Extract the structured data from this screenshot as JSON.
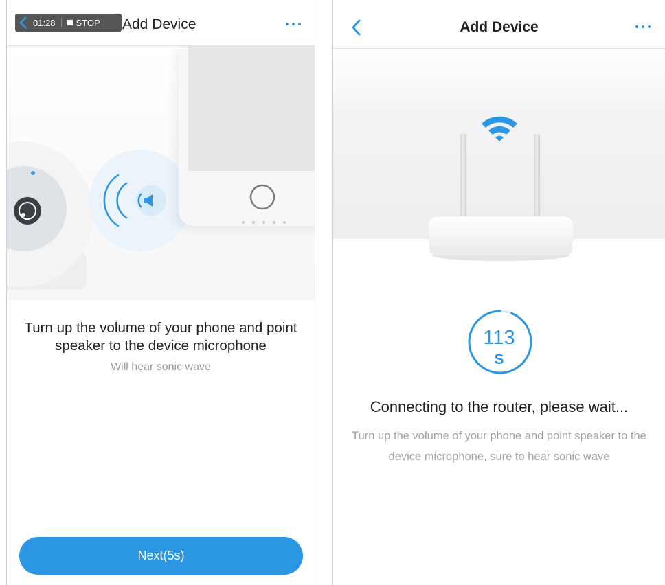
{
  "left_screen": {
    "recording": {
      "time": "01:28",
      "stop_label": "STOP"
    },
    "header": {
      "title": "Add Device"
    },
    "instructions": {
      "main": "Turn up the volume of your phone and point speaker to the device microphone",
      "sub": "Will hear sonic wave"
    },
    "next_button": {
      "label": "Next(5s)"
    }
  },
  "right_screen": {
    "header": {
      "title": "Add Device"
    },
    "countdown": {
      "value": "113",
      "unit": "S",
      "progress_remaining": 0.94
    },
    "status": {
      "title": "Connecting to the router, please wait...",
      "detail": "Turn up the volume of your phone and point speaker to the device microphone, sure to hear sonic wave"
    }
  },
  "colors": {
    "accent": "#2b96e4",
    "text": "#222222",
    "muted": "#9a9a9a"
  },
  "icons": [
    "back-chevron-icon",
    "more-dots-icon",
    "stop-square-icon",
    "wifi-icon",
    "speaker-icon",
    "sound-wave-icon"
  ]
}
